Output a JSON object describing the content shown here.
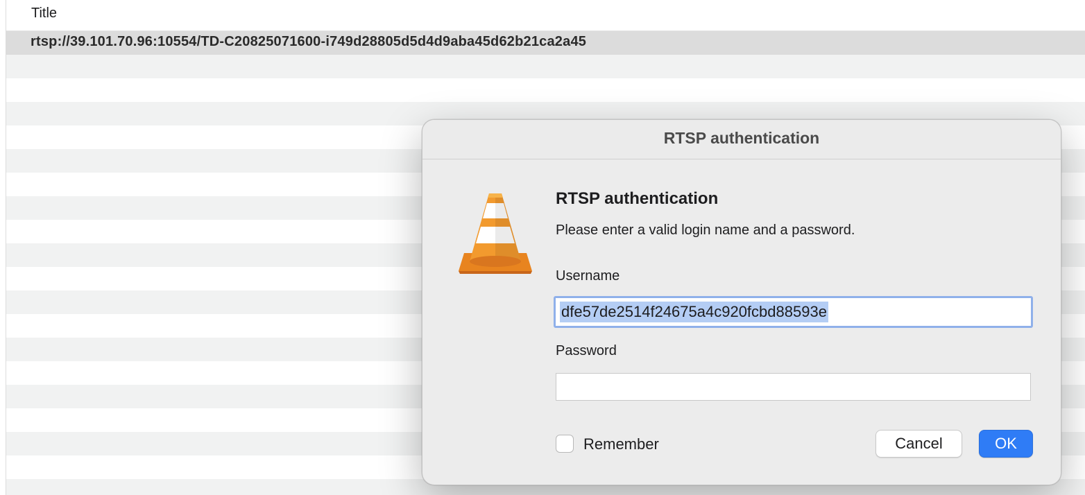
{
  "playlist": {
    "column_title": "Title",
    "rows": [
      {
        "title": "rtsp://39.101.70.96:10554/TD-C20825071600-i749d28805d5d4d9aba45d62b21ca2a45"
      }
    ]
  },
  "dialog": {
    "window_title": "RTSP authentication",
    "heading": "RTSP authentication",
    "message": "Please enter a valid login name and a password.",
    "icon": "vlc-cone-icon",
    "username_label": "Username",
    "username_value": "dfe57de2514f24675a4c920fcbd88593e",
    "password_label": "Password",
    "password_value": "",
    "remember_label": "Remember",
    "remember_checked": false,
    "cancel_label": "Cancel",
    "ok_label": "OK"
  },
  "colors": {
    "accent": "#2f7cf6",
    "selection": "#b4cdf4",
    "focus_ring": "#8fb0ea",
    "cone_orange": "#e8841f",
    "row_alt": "#f1f2f2",
    "row_selected": "#dcdcdc"
  }
}
